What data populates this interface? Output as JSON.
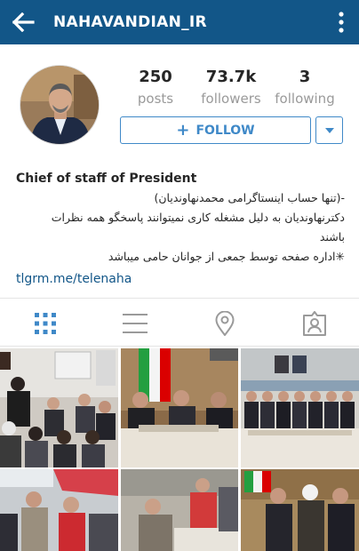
{
  "header": {
    "username": "NAHAVANDIAN_IR",
    "back_icon": "back-arrow-icon",
    "menu_icon": "more-vertical-icon",
    "background_color": "#125688"
  },
  "profile": {
    "stats": [
      {
        "count": "250",
        "label": "posts"
      },
      {
        "count": "73.7k",
        "label": "followers"
      },
      {
        "count": "3",
        "label": "following"
      }
    ],
    "follow_label": "FOLLOW",
    "follow_icon": "plus-icon",
    "dropdown_icon": "caret-down-icon",
    "accent_color": "#3f89c8"
  },
  "bio": {
    "full_name": "Chief of staff of President",
    "lines": [
      "-(تنها حساب اینستاگرامی محمدنهاوندیان)",
      "دکترنهاوندیان به دلیل مشغله کاری نمیتوانند پاسخگو همه نظرات",
      "باشند",
      "✳اداره صفحه توسط جمعی از جوانان حامی میباشد"
    ],
    "link": "tlgrm.me/telenaha"
  },
  "tabs": [
    {
      "name": "grid-view",
      "icon": "grid-icon"
    },
    {
      "name": "list-view",
      "icon": "list-icon"
    },
    {
      "name": "location-view",
      "icon": "location-pin-icon"
    },
    {
      "name": "tagged-view",
      "icon": "tagged-person-icon"
    }
  ]
}
